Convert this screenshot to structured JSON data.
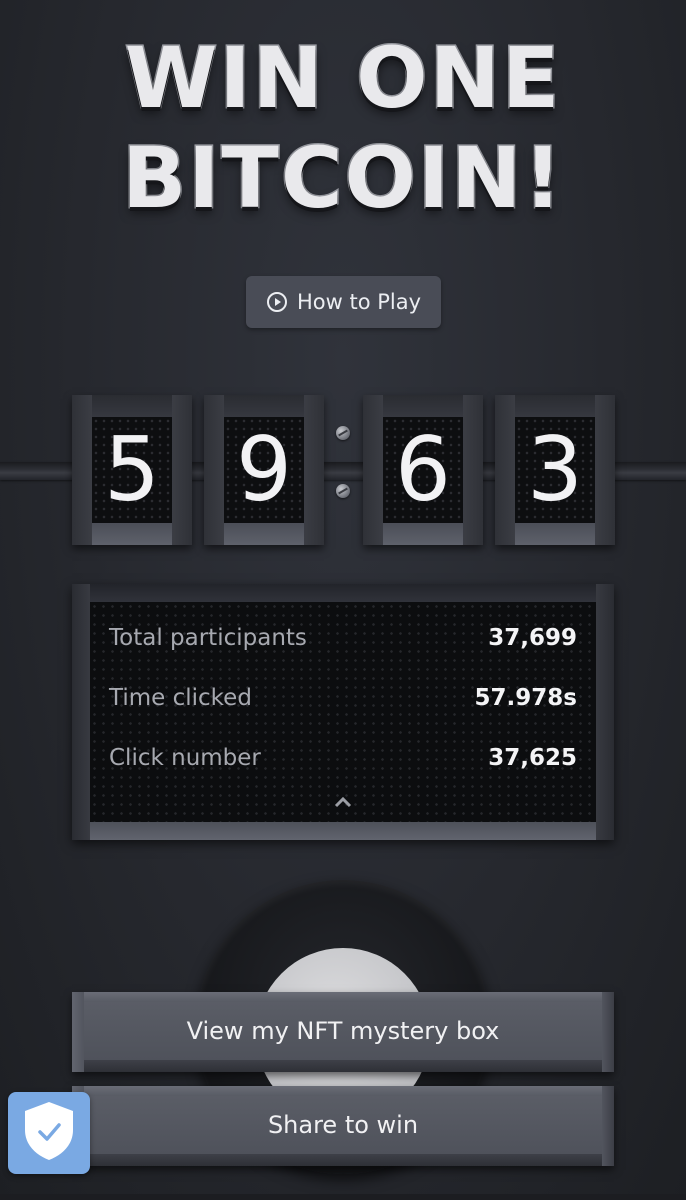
{
  "title": {
    "line1": "WIN ONE",
    "line2": "BITCOIN!"
  },
  "how_to_play": {
    "label": "How to Play",
    "icon": "play-circle-icon"
  },
  "timer": {
    "digits": [
      "5",
      "9",
      "6",
      "3"
    ]
  },
  "stats": {
    "rows": [
      {
        "label": "Total participants",
        "value": "37,699"
      },
      {
        "label": "Time clicked",
        "value": "57.978s"
      },
      {
        "label": "Click number",
        "value": "37,625"
      }
    ],
    "toggle_icon": "chevron-up-icon"
  },
  "actions": {
    "nft_label": "View my NFT mystery box",
    "share_label": "Share to win"
  },
  "badge": {
    "icon": "shield-check-icon",
    "color": "#7aa9e3"
  },
  "colors": {
    "background": "#26282e",
    "button": "#494c56",
    "digit_face": "#0d0e10"
  }
}
